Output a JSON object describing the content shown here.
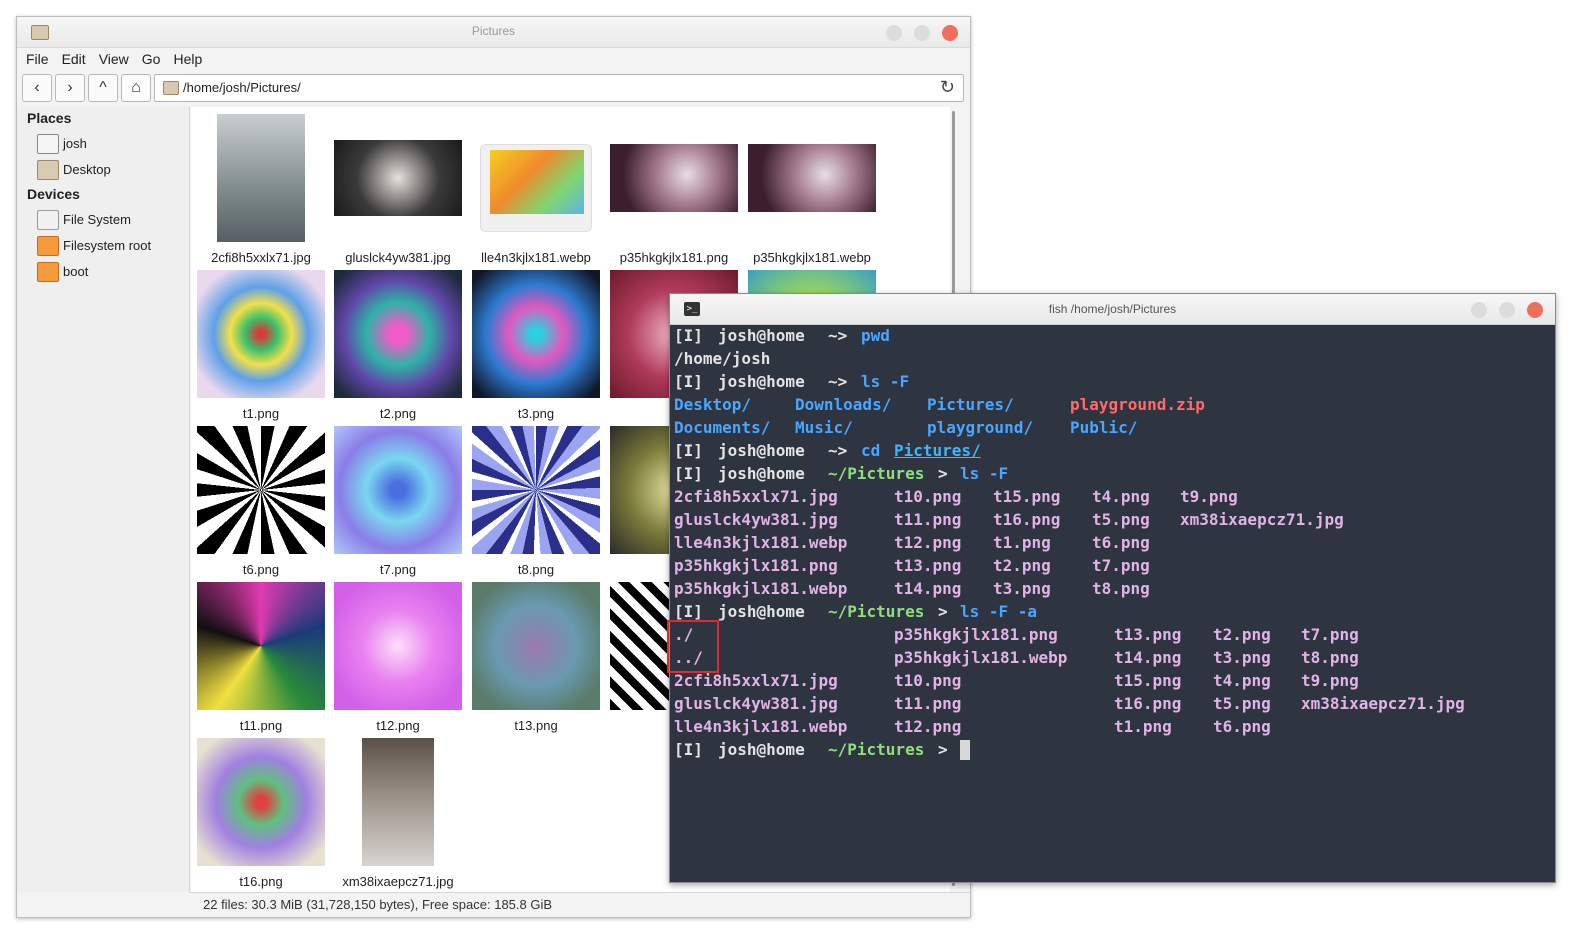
{
  "file_manager": {
    "title": "Pictures",
    "menu": [
      "File",
      "Edit",
      "View",
      "Go",
      "Help"
    ],
    "path": "/home/josh/Pictures/",
    "sidebar": {
      "places_header": "Places",
      "places": [
        "josh",
        "Desktop"
      ],
      "devices_header": "Devices",
      "devices": [
        "File System",
        "Filesystem root",
        "boot"
      ]
    },
    "files": [
      "2cfi8h5xxlx71.jpg",
      "gluslck4yw381.jpg",
      "lle4n3kjlx181.webp",
      "p35hkgkjlx181.png",
      "p35hkgkjlx181.webp",
      "t1.png",
      "t2.png",
      "t3.png",
      "t4",
      "",
      "t6.png",
      "t7.png",
      "t8.png",
      "t9",
      "",
      "t11.png",
      "t12.png",
      "t13.png",
      "t14",
      "",
      "t16.png",
      "xm38ixaepcz71.jpg"
    ],
    "status": "22 files: 30.3 MiB (31,728,150 bytes), Free space: 185.8 GiB"
  },
  "terminal": {
    "title": "fish /home/josh/Pictures",
    "lines": [
      [
        [
          "[I] ",
          "white"
        ],
        [
          "josh@home ",
          "white"
        ],
        [
          "~> ",
          "white"
        ],
        [
          "pwd",
          "blue"
        ]
      ],
      [
        [
          "/home/josh",
          "white"
        ]
      ],
      [
        [
          "[I] ",
          "white"
        ],
        [
          "josh@home ",
          "white"
        ],
        [
          "~> ",
          "white"
        ],
        [
          "ls -F",
          "blue"
        ]
      ],
      [
        [
          "Desktop/",
          "blue",
          0
        ],
        [
          "Downloads/",
          "blue",
          11
        ],
        [
          "Pictures/",
          "blue",
          23
        ],
        [
          "playground.zip",
          "red",
          36
        ]
      ],
      [
        [
          "Documents/",
          "blue",
          0
        ],
        [
          "Music/",
          "blue",
          11
        ],
        [
          "playground/",
          "blue",
          23
        ],
        [
          "Public/",
          "blue",
          36
        ]
      ],
      [
        [
          "[I] ",
          "white"
        ],
        [
          "josh@home ",
          "white"
        ],
        [
          "~> ",
          "white"
        ],
        [
          "cd ",
          "blue"
        ],
        [
          "Pictures/",
          "link"
        ]
      ],
      [
        [
          "[I] ",
          "white"
        ],
        [
          "josh@home ",
          "white"
        ],
        [
          "~/Pictures",
          "green"
        ],
        [
          "> ",
          "white"
        ],
        [
          "ls -F",
          "blue"
        ]
      ],
      [
        [
          "2cfi8h5xxlx71.jpg",
          "pink",
          0
        ],
        [
          "t10.png",
          "pink",
          20
        ],
        [
          "t15.png",
          "pink",
          29
        ],
        [
          "t4.png",
          "pink",
          38
        ],
        [
          "t9.png",
          "pink",
          46
        ]
      ],
      [
        [
          "gluslck4yw381.jpg",
          "pink",
          0
        ],
        [
          "t11.png",
          "pink",
          20
        ],
        [
          "t16.png",
          "pink",
          29
        ],
        [
          "t5.png",
          "pink",
          38
        ],
        [
          "xm38ixaepcz71.jpg",
          "pink",
          46
        ]
      ],
      [
        [
          "lle4n3kjlx181.webp",
          "pink",
          0
        ],
        [
          "t12.png",
          "pink",
          20
        ],
        [
          "t1.png",
          "pink",
          29
        ],
        [
          "t6.png",
          "pink",
          38
        ]
      ],
      [
        [
          "p35hkgkjlx181.png",
          "pink",
          0
        ],
        [
          "t13.png",
          "pink",
          20
        ],
        [
          "t2.png",
          "pink",
          29
        ],
        [
          "t7.png",
          "pink",
          38
        ]
      ],
      [
        [
          "p35hkgkjlx181.webp",
          "pink",
          0
        ],
        [
          "t14.png",
          "pink",
          20
        ],
        [
          "t3.png",
          "pink",
          29
        ],
        [
          "t8.png",
          "pink",
          38
        ]
      ],
      [
        [
          "[I] ",
          "white"
        ],
        [
          "josh@home ",
          "white"
        ],
        [
          "~/Pictures",
          "green"
        ],
        [
          "> ",
          "white"
        ],
        [
          "ls -F -a",
          "blue"
        ]
      ],
      [
        [
          "./",
          "pink",
          0
        ],
        [
          "p35hkgkjlx181.png",
          "pink",
          20
        ],
        [
          "t13.png",
          "pink",
          40
        ],
        [
          "t2.png",
          "pink",
          49
        ],
        [
          "t7.png",
          "pink",
          57
        ]
      ],
      [
        [
          "../",
          "pink",
          0
        ],
        [
          "p35hkgkjlx181.webp",
          "pink",
          20
        ],
        [
          "t14.png",
          "pink",
          40
        ],
        [
          "t3.png",
          "pink",
          49
        ],
        [
          "t8.png",
          "pink",
          57
        ]
      ],
      [
        [
          "2cfi8h5xxlx71.jpg",
          "pink",
          0
        ],
        [
          "t10.png",
          "pink",
          20
        ],
        [
          "t15.png",
          "pink",
          40
        ],
        [
          "t4.png",
          "pink",
          49
        ],
        [
          "t9.png",
          "pink",
          57
        ]
      ],
      [
        [
          "gluslck4yw381.jpg",
          "pink",
          0
        ],
        [
          "t11.png",
          "pink",
          20
        ],
        [
          "t16.png",
          "pink",
          40
        ],
        [
          "t5.png",
          "pink",
          49
        ],
        [
          "xm38ixaepcz71.jpg",
          "pink",
          57
        ]
      ],
      [
        [
          "lle4n3kjlx181.webp",
          "pink",
          0
        ],
        [
          "t12.png",
          "pink",
          20
        ],
        [
          "t1.png",
          "pink",
          40
        ],
        [
          "t6.png",
          "pink",
          49
        ]
      ],
      [
        [
          "[I] ",
          "white"
        ],
        [
          "josh@home ",
          "white"
        ],
        [
          "~/Pictures",
          "green"
        ],
        [
          "> ",
          "white"
        ]
      ]
    ]
  }
}
